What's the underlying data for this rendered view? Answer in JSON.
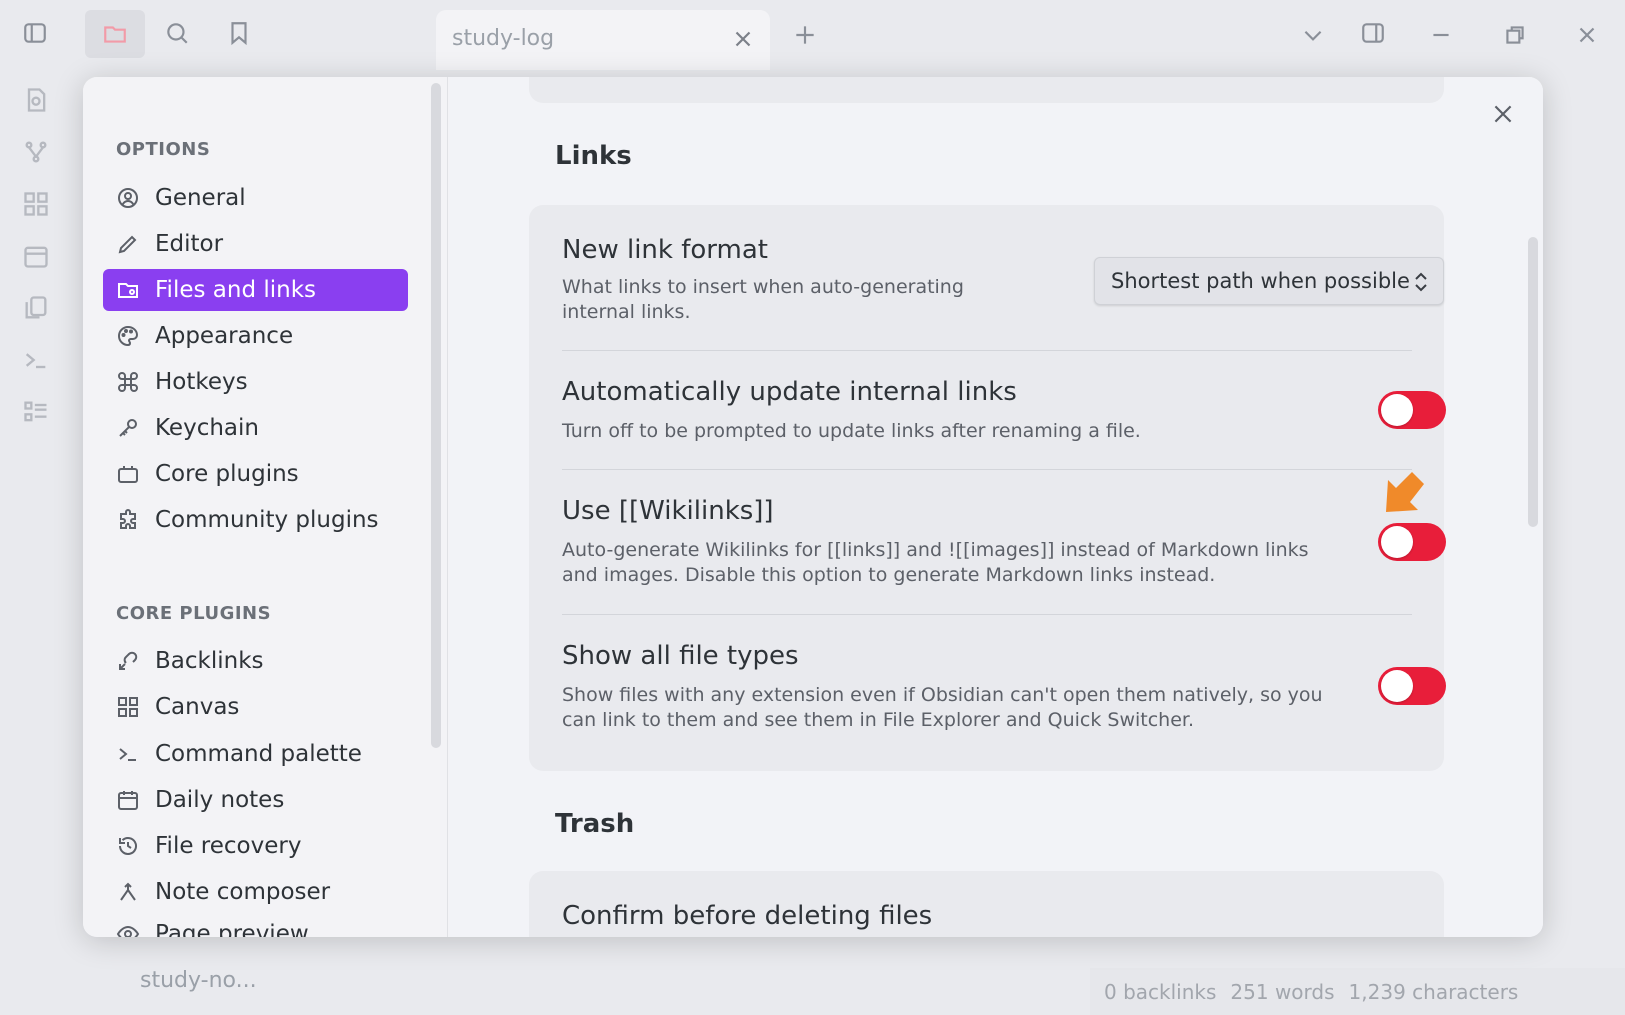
{
  "tab": {
    "title": "study-log"
  },
  "vault": {
    "name": "study-no..."
  },
  "status": {
    "backlinks": "0 backlinks",
    "words": "251 words",
    "characters": "1,239 characters"
  },
  "sidebar": {
    "options_heading": "OPTIONS",
    "options": [
      {
        "label": "General",
        "icon": "user-circle-icon"
      },
      {
        "label": "Editor",
        "icon": "pencil-icon"
      },
      {
        "label": "Files and links",
        "icon": "folder-cog-icon",
        "active": true
      },
      {
        "label": "Appearance",
        "icon": "palette-icon"
      },
      {
        "label": "Hotkeys",
        "icon": "command-icon"
      },
      {
        "label": "Keychain",
        "icon": "key-icon"
      },
      {
        "label": "Core plugins",
        "icon": "plugin-box-icon"
      },
      {
        "label": "Community plugins",
        "icon": "puzzle-icon"
      }
    ],
    "core_heading": "CORE PLUGINS",
    "core_plugins": [
      {
        "label": "Backlinks",
        "icon": "backlink-icon"
      },
      {
        "label": "Canvas",
        "icon": "grid-icon"
      },
      {
        "label": "Command palette",
        "icon": "terminal-icon"
      },
      {
        "label": "Daily notes",
        "icon": "calendar-icon"
      },
      {
        "label": "File recovery",
        "icon": "history-icon"
      },
      {
        "label": "Note composer",
        "icon": "merge-icon"
      },
      {
        "label": "Page preview",
        "icon": "preview-icon"
      }
    ]
  },
  "links": {
    "title": "Links",
    "new_link_format": {
      "name": "New link format",
      "desc_line1": "What links to insert when auto-generating",
      "desc_line2": "internal links.",
      "value": "Shortest path when possible"
    },
    "auto_update": {
      "name": "Automatically update internal links",
      "desc_line1": "Turn off to be prompted to update links after renaming a file.",
      "enabled": false
    },
    "wikilinks": {
      "name": "Use [[Wikilinks]]",
      "desc_line1": "Auto-generate Wikilinks for [[links]] and ![[images]] instead of Markdown links",
      "desc_line2": "and images. Disable this option to generate Markdown links instead.",
      "enabled": false
    },
    "show_all": {
      "name": "Show all file types",
      "desc_line1": "Show files with any extension even if Obsidian can't open them natively, so you",
      "desc_line2": "can link to them and see them in File Explorer and Quick Switcher.",
      "enabled": false
    }
  },
  "trash": {
    "title": "Trash",
    "confirm_delete": {
      "name": "Confirm before deleting files",
      "enabled": true
    }
  },
  "colors": {
    "accent": "#8a3ff0",
    "toggle_off": "#e81e3a",
    "toggle_on": "#24b13a",
    "marker": "#f08a2a"
  }
}
